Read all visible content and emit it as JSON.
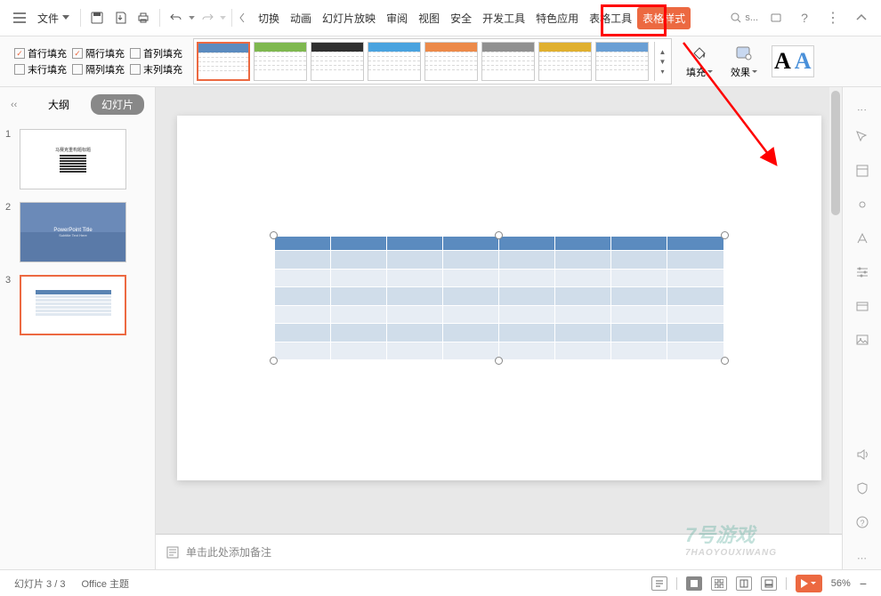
{
  "toolbar": {
    "file_label": "文件",
    "tabs": [
      "切换",
      "动画",
      "幻灯片放映",
      "审阅",
      "视图",
      "安全",
      "开发工具",
      "特色应用",
      "表格工具",
      "表格样式"
    ],
    "active_tab_index": 9,
    "search_placeholder": "s..."
  },
  "ribbon": {
    "fill_options": {
      "row1": [
        {
          "label": "首行填充",
          "checked": true
        },
        {
          "label": "隔行填充",
          "checked": true
        },
        {
          "label": "首列填充",
          "checked": false
        }
      ],
      "row2": [
        {
          "label": "末行填充",
          "checked": false
        },
        {
          "label": "隔列填充",
          "checked": false
        },
        {
          "label": "末列填充",
          "checked": false
        }
      ]
    },
    "style_colors": [
      "#5b8bbf",
      "#7fb850",
      "#303030",
      "#4aa3df",
      "#ec8a4a",
      "#909090",
      "#e0b030",
      "#6a9fd4"
    ],
    "fill_btn": "填充",
    "effect_btn": "效果"
  },
  "side": {
    "outline_tab": "大纲",
    "slides_tab": "幻灯片",
    "thumbs": [
      {
        "num": "1"
      },
      {
        "num": "2",
        "title": "PowerPoint Title",
        "subtitle": "Subtitle Text Here"
      },
      {
        "num": "3"
      }
    ]
  },
  "notes": {
    "placeholder": "单击此处添加备注"
  },
  "status": {
    "slide_info": "幻灯片 3 / 3",
    "theme": "Office 主题",
    "zoom": "56%"
  },
  "chart_data": {
    "type": "table",
    "title": "",
    "columns": 8,
    "rows": 7,
    "header_color": "#5b8bbf",
    "band_colors": [
      "#d0ddea",
      "#e7edf4"
    ],
    "cells": []
  }
}
